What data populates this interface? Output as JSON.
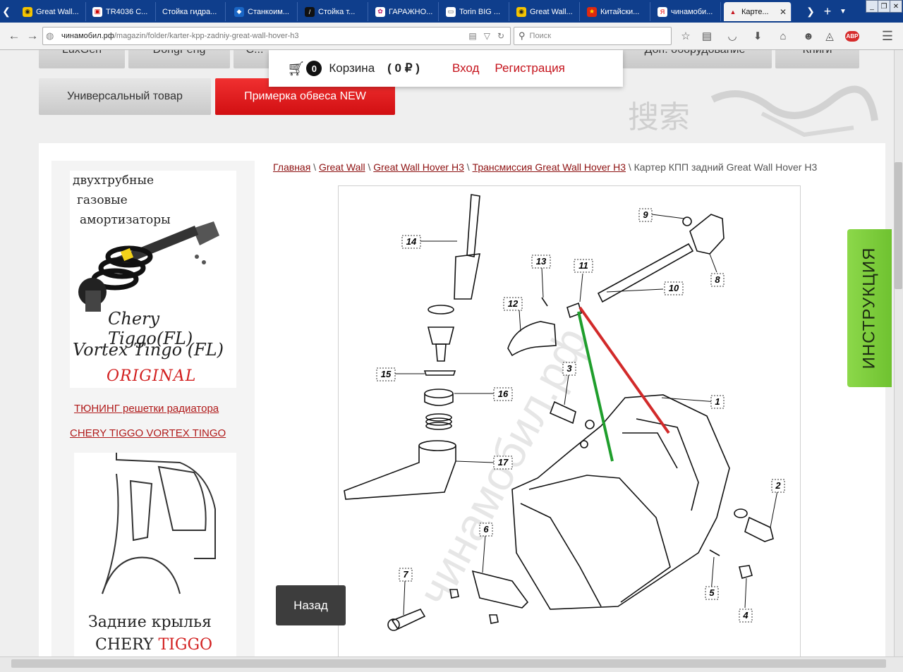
{
  "tabs": [
    {
      "label": "Great Wall...",
      "icon": "gw-logo-icon"
    },
    {
      "label": "TR4036 C...",
      "icon": "tr-logo-icon"
    },
    {
      "label": "Стойка гидра...",
      "icon": ""
    },
    {
      "label": "Станкоим...",
      "icon": "cube-icon"
    },
    {
      "label": "Стойка т...",
      "icon": "logo-icon"
    },
    {
      "label": "ГАРАЖНО...",
      "icon": "flower-icon"
    },
    {
      "label": "Torin BIG ...",
      "icon": "page-icon"
    },
    {
      "label": "Great Wall...",
      "icon": "gw-logo-icon"
    },
    {
      "label": "Китайски...",
      "icon": "china-flag-icon"
    },
    {
      "label": "чинамоби...",
      "icon": "yandex-icon"
    },
    {
      "label": "Карте...",
      "icon": "site-icon",
      "active": true
    }
  ],
  "nav": {
    "url_domain": "чинамобил.рф",
    "url_path": "/magazin/folder/karter-kpp-zadniy-great-wall-hover-h3",
    "search_placeholder": "Поиск",
    "abp_label": "ABP"
  },
  "top_categories": [
    "LuxGen",
    "DongFeng",
    "C...",
    "Доп. оборудование",
    "Книги"
  ],
  "category_buttons": [
    {
      "label": "Универсальный товар",
      "style": "gray"
    },
    {
      "label": "Примерка обвеса NEW",
      "style": "red"
    }
  ],
  "cart": {
    "count": "0",
    "label": "Корзина",
    "amount": "0 ₽",
    "login": "Вход",
    "register": "Регистрация"
  },
  "sidebar": {
    "ad1": {
      "line1": "двухтрубные",
      "line2": "газовые",
      "line3": "амортизаторы",
      "model1": "Chery Tiggo(FL)",
      "model2": "Vortex Tingo (FL)",
      "tag": "ORIGINAL"
    },
    "link1": "ТЮНИНГ решетки радиатора",
    "link2": "CHERY TIGGO VORTEX TINGO",
    "ad2": {
      "title": "Задние крылья",
      "brand1": "CHERY",
      "brand2": "TIGGO"
    }
  },
  "breadcrumb": {
    "items": [
      "Главная",
      "Great Wall",
      "Great Wall Hover H3",
      "Трансмиссия Great Wall Hover H3"
    ],
    "separator": " \\ ",
    "current": "Картер КПП задний Great Wall Hover H3"
  },
  "diagram": {
    "watermark": "чинамобил.рф",
    "part_numbers": [
      "1",
      "2",
      "3",
      "4",
      "5",
      "6",
      "7",
      "8",
      "9",
      "10",
      "11",
      "12",
      "13",
      "14",
      "15",
      "16",
      "17"
    ]
  },
  "back_button": "Назад",
  "instruction_tab": "ИНСТРУКЦИЯ",
  "colors": {
    "accent_red": "#d10f12",
    "link_red": "#8d1010",
    "green_tab": "#7ccb3a",
    "tabbar_blue": "#0f3e8c"
  }
}
